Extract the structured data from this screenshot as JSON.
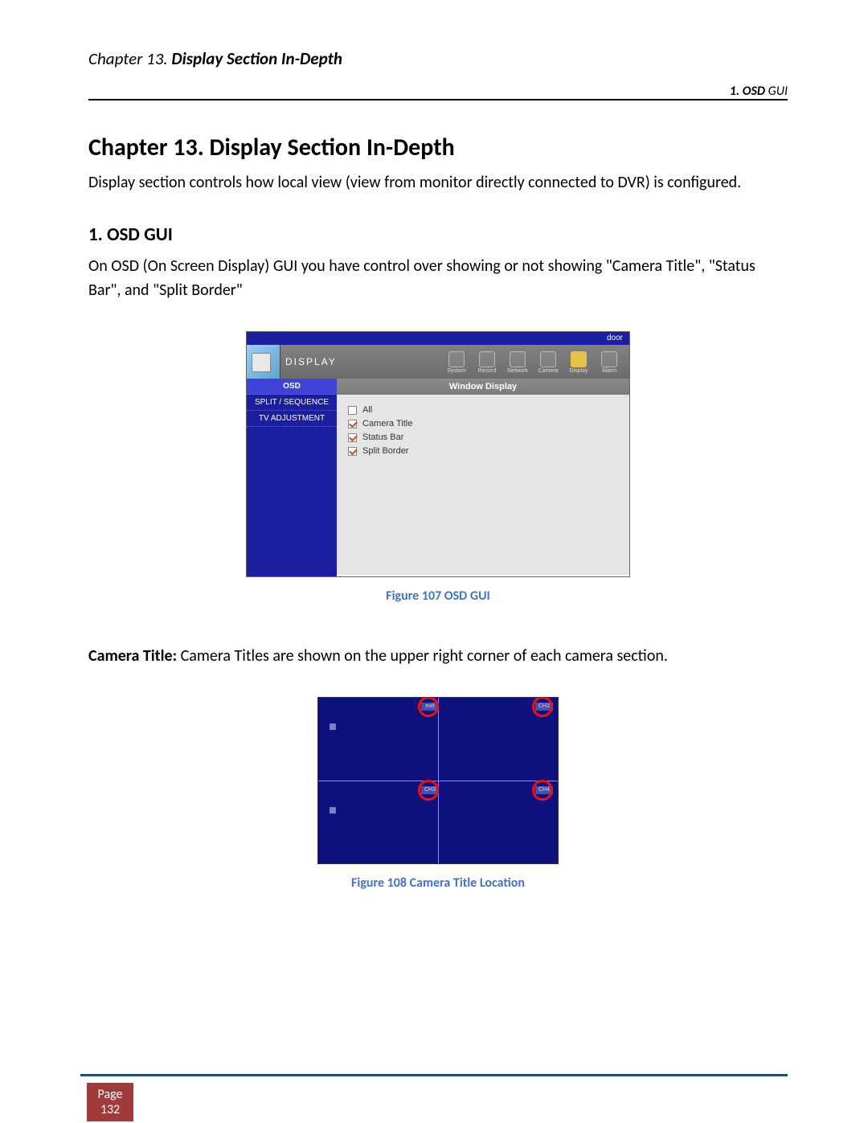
{
  "header": {
    "chapter_prefix": "Chapter 13. ",
    "chapter_title": "Display Section In-Depth",
    "section_no": "1. ",
    "section_bold": "OSD ",
    "section_rest": "GUI"
  },
  "main": {
    "h1": "Chapter 13. Display Section In-Depth",
    "intro": "Display section controls how local view (view from monitor directly connected to DVR) is configured.",
    "h2": "1. OSD GUI",
    "osd_para": "On OSD (On Screen Display) GUI you have control over showing or not showing \"Camera Title\", \"Status Bar\", and \"Split Border\""
  },
  "figure107": {
    "top_label": "door",
    "panel_title": "DISPLAY",
    "nav": [
      "System",
      "Record",
      "Network",
      "Camera",
      "Display",
      "Alarm"
    ],
    "sidebar": [
      "OSD",
      "SPLIT / SEQUENCE",
      "TV ADJUSTMENT"
    ],
    "main_header": "Window Display",
    "options": [
      {
        "label": "All",
        "checked": false
      },
      {
        "label": "Camera Title",
        "checked": true
      },
      {
        "label": "Status Bar",
        "checked": true
      },
      {
        "label": "Split Border",
        "checked": true
      }
    ],
    "caption": "Figure 107 OSD GUI"
  },
  "camera_title": {
    "lead_bold": "Camera Title: ",
    "lead_rest": "Camera Titles are shown on the upper right corner of each camera section."
  },
  "figure108": {
    "labels": [
      "exit",
      "CH2",
      "CH3",
      "CH4"
    ],
    "caption": "Figure 108 Camera Title Location"
  },
  "footer": {
    "page_word": "Page",
    "page_no": "132"
  }
}
